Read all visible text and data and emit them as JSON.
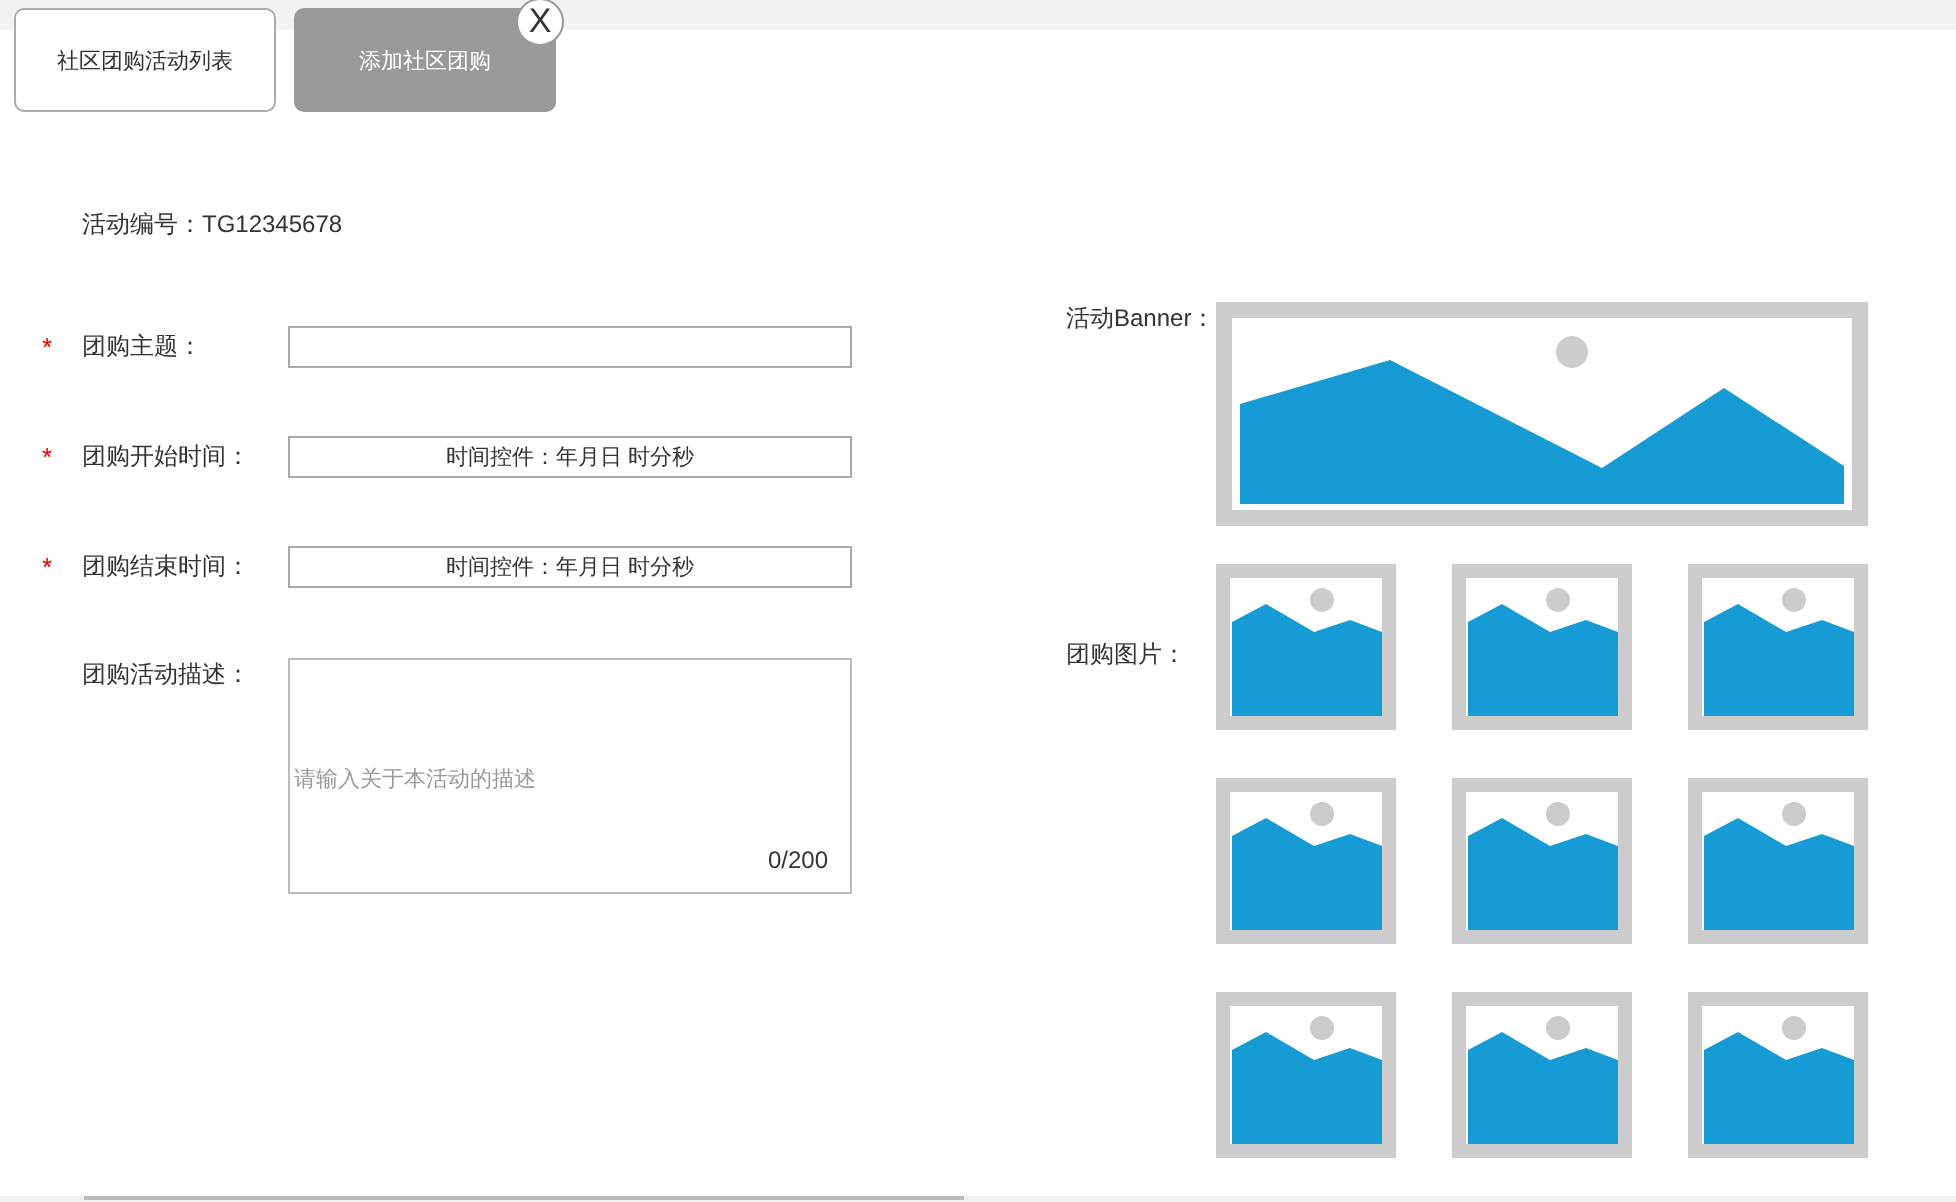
{
  "tabs": [
    {
      "label": "社区团购活动列表",
      "selected": false
    },
    {
      "label": "添加社区团购",
      "selected": true,
      "close": "X"
    }
  ],
  "activity_id": "活动编号：TG12345678",
  "fields": [
    {
      "required_mark": "*",
      "label": "团购主题：",
      "kind": "text"
    },
    {
      "required_mark": "*",
      "label": "团购开始时间：",
      "kind": "datetime",
      "value": "时间控件：年月日 时分秒"
    },
    {
      "required_mark": "*",
      "label": "团购结束时间：",
      "kind": "datetime",
      "value": "时间控件：年月日 时分秒"
    },
    {
      "label": "团购活动描述：",
      "kind": "textarea",
      "placeholder": "请输入关于本活动的描述",
      "counter": "0/200"
    }
  ],
  "banner": {
    "label": "活动Banner："
  },
  "gallery": {
    "label": "团购图片：",
    "images": [
      {
        "kind": "placeholder"
      },
      {
        "kind": "placeholder"
      },
      {
        "kind": "placeholder"
      },
      {
        "kind": "placeholder"
      },
      {
        "kind": "placeholder"
      },
      {
        "kind": "placeholder"
      },
      {
        "kind": "placeholder"
      },
      {
        "kind": "placeholder"
      },
      {
        "kind": "placeholder"
      }
    ]
  }
}
